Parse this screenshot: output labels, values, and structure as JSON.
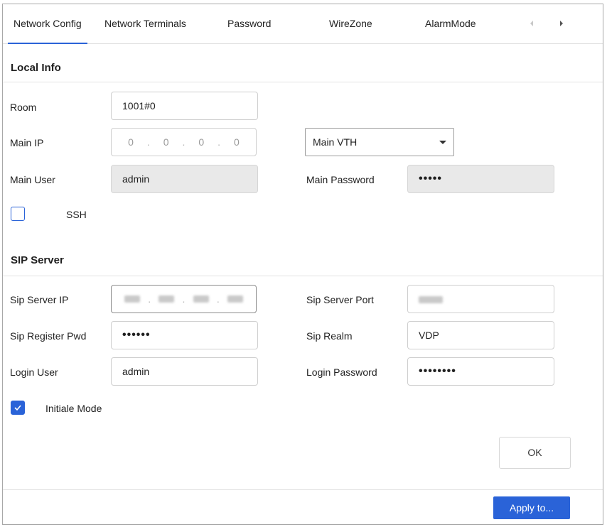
{
  "tabs": [
    {
      "label": "Network Config",
      "active": true
    },
    {
      "label": "Network Terminals",
      "active": false
    },
    {
      "label": "Password",
      "active": false
    },
    {
      "label": "WireZone",
      "active": false
    },
    {
      "label": "AlarmMode",
      "active": false
    }
  ],
  "tab_nav": {
    "prev_icon": "chevron-left-icon",
    "next_icon": "caret-right-icon"
  },
  "local_info": {
    "title": "Local Info",
    "room": {
      "label": "Room",
      "value": "1001#0"
    },
    "main_ip": {
      "label": "Main IP",
      "octets": [
        "0",
        "0",
        "0",
        "0"
      ]
    },
    "main_device": {
      "value": "Main VTH"
    },
    "main_user": {
      "label": "Main User",
      "value": "admin"
    },
    "main_password": {
      "label": "Main Password",
      "value": "•••••"
    },
    "ssh": {
      "label": "SSH",
      "checked": false
    }
  },
  "sip_server": {
    "title": "SIP Server",
    "sip_server_ip": {
      "label": "Sip Server IP"
    },
    "sip_server_port": {
      "label": "Sip Server Port"
    },
    "sip_register_pwd": {
      "label": "Sip Register Pwd",
      "value": "••••••"
    },
    "sip_realm": {
      "label": "Sip Realm",
      "value": "VDP"
    },
    "login_user": {
      "label": "Login User",
      "value": "admin"
    },
    "login_password": {
      "label": "Login Password",
      "value": "••••••••"
    },
    "initiale_mode": {
      "label": "Initiale Mode",
      "checked": true
    }
  },
  "buttons": {
    "ok": "OK",
    "apply": "Apply to..."
  },
  "colors": {
    "accent": "#2a63d8",
    "disabled_bg": "#e9e9e9",
    "border": "#cfcfcf"
  }
}
